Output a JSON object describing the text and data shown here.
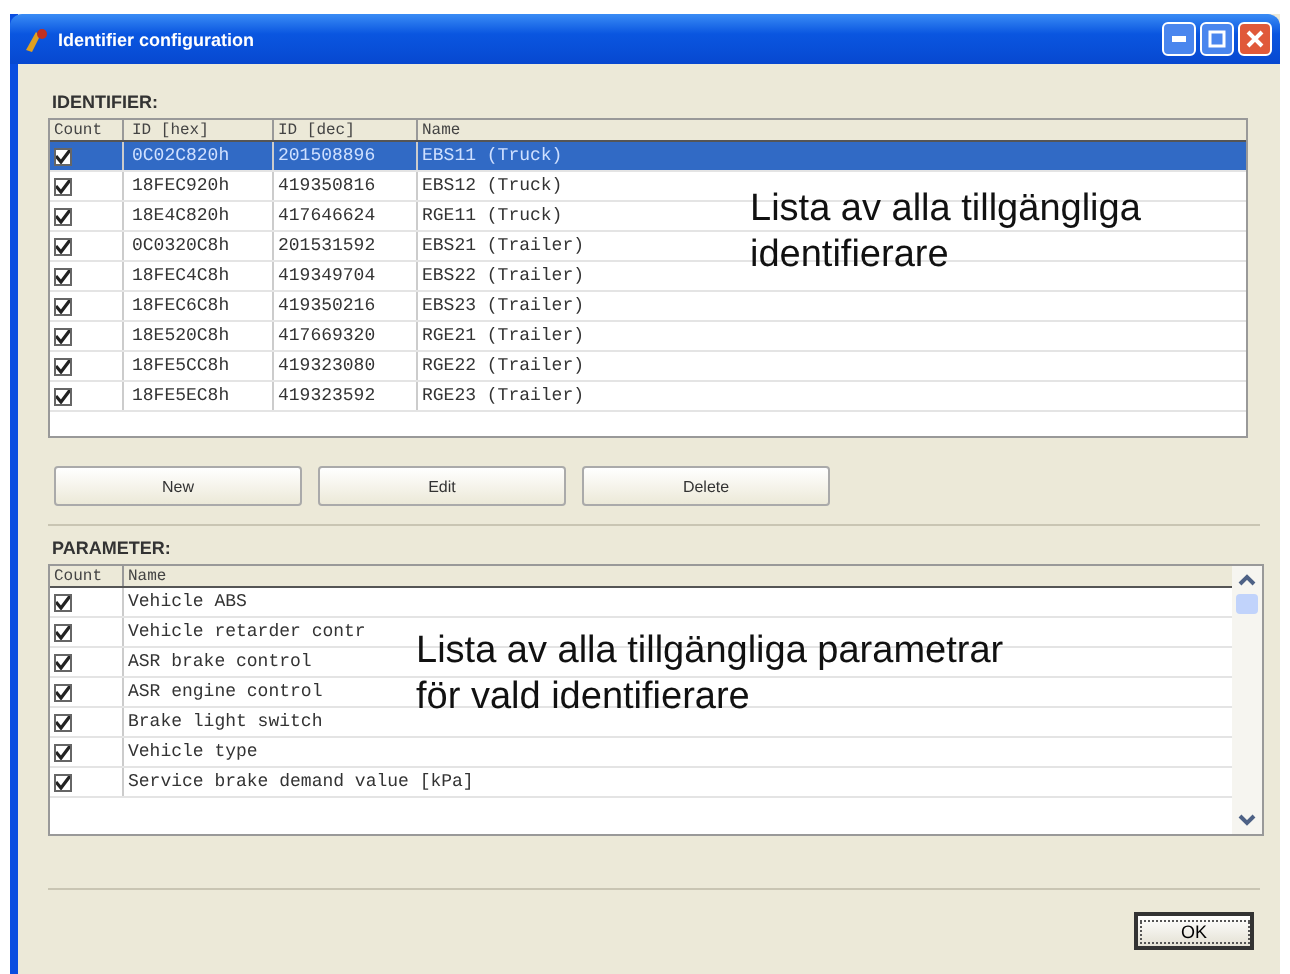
{
  "window": {
    "title": "Identifier configuration"
  },
  "identifier": {
    "label": "IDENTIFIER:",
    "columns": [
      "Count",
      "ID [hex]",
      "ID [dec]",
      "Name"
    ],
    "rows": [
      {
        "checked": true,
        "selected": true,
        "hex": "0C02C820h",
        "dec": "201508896",
        "name": "EBS11 (Truck)"
      },
      {
        "checked": true,
        "selected": false,
        "hex": "18FEC920h",
        "dec": "419350816",
        "name": "EBS12 (Truck)"
      },
      {
        "checked": true,
        "selected": false,
        "hex": "18E4C820h",
        "dec": "417646624",
        "name": "RGE11 (Truck)"
      },
      {
        "checked": true,
        "selected": false,
        "hex": "0C0320C8h",
        "dec": "201531592",
        "name": "EBS21 (Trailer)"
      },
      {
        "checked": true,
        "selected": false,
        "hex": "18FEC4C8h",
        "dec": "419349704",
        "name": "EBS22 (Trailer)"
      },
      {
        "checked": true,
        "selected": false,
        "hex": "18FEC6C8h",
        "dec": "419350216",
        "name": "EBS23 (Trailer)"
      },
      {
        "checked": true,
        "selected": false,
        "hex": "18E520C8h",
        "dec": "417669320",
        "name": "RGE21 (Trailer)"
      },
      {
        "checked": true,
        "selected": false,
        "hex": "18FE5CC8h",
        "dec": "419323080",
        "name": "RGE22 (Trailer)"
      },
      {
        "checked": true,
        "selected": false,
        "hex": "18FE5EC8h",
        "dec": "419323592",
        "name": "RGE23 (Trailer)"
      }
    ]
  },
  "buttons": [
    "New",
    "Edit",
    "Delete"
  ],
  "parameter": {
    "label": "PARAMETER:",
    "columns": [
      "Count",
      "Name"
    ],
    "rows": [
      {
        "checked": true,
        "name": "Vehicle ABS"
      },
      {
        "checked": true,
        "name": "Vehicle retarder contr"
      },
      {
        "checked": true,
        "name": "ASR brake control"
      },
      {
        "checked": true,
        "name": "ASR engine control"
      },
      {
        "checked": true,
        "name": "Brake light switch"
      },
      {
        "checked": true,
        "name": "Vehicle type"
      },
      {
        "checked": true,
        "name": "Service brake demand value [kPa]"
      }
    ]
  },
  "ok_button": "OK",
  "annotations": [
    {
      "lines": [
        "Lista av alla tillgängliga",
        "identifierare"
      ]
    },
    {
      "lines": [
        "Lista av alla tillgängliga parametrar",
        "för vald identifierare"
      ]
    }
  ]
}
